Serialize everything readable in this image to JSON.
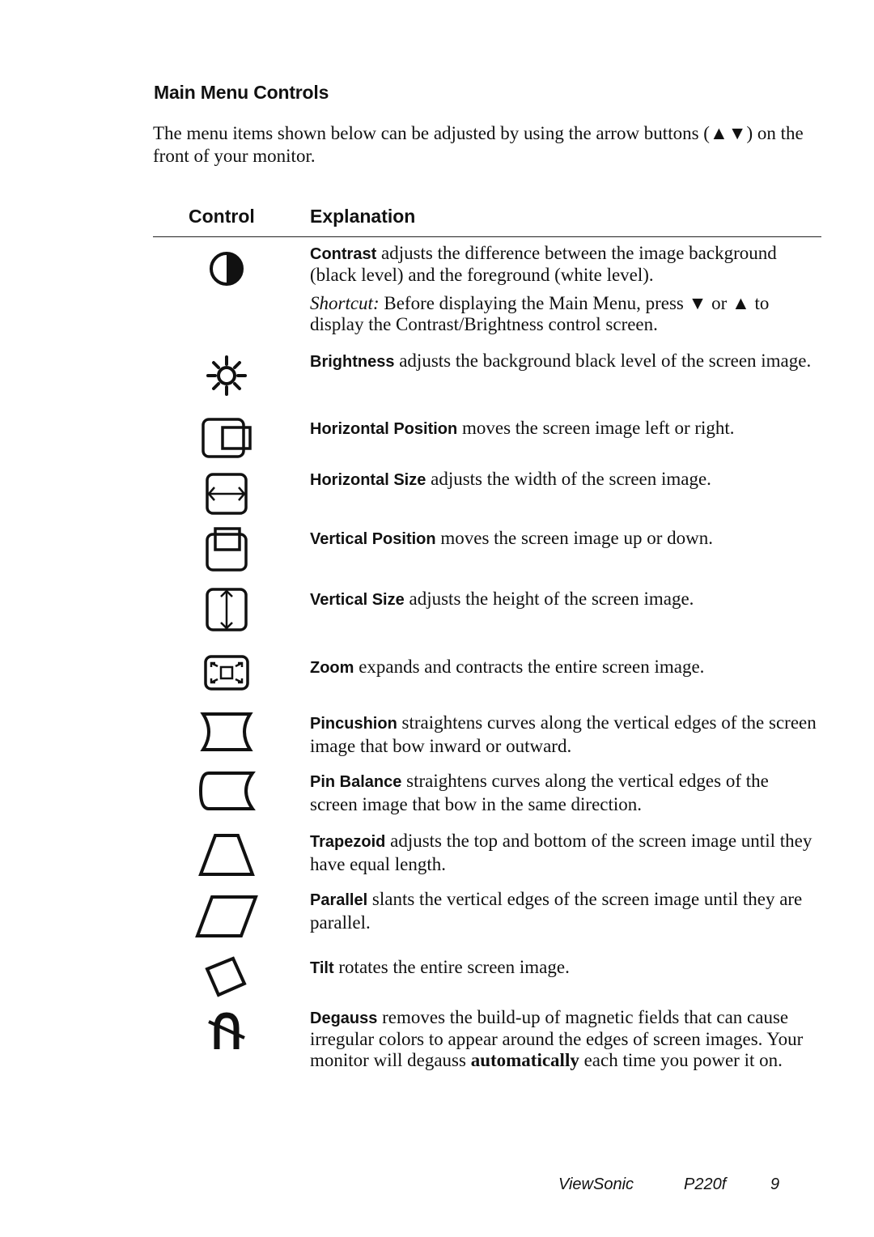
{
  "section": {
    "title": "Main Menu Controls",
    "intro": "The menu items shown below can be adjusted by using the arrow buttons (▲▼) on the front of your monitor."
  },
  "table": {
    "headers": {
      "control": "Control",
      "explanation": "Explanation"
    },
    "rows": [
      {
        "icon": "contrast-icon",
        "term": "Contrast",
        "text": " adjusts the difference between the image background (black level) and the foreground (white level).",
        "shortcut_label": "Shortcut:",
        "shortcut_text": " Before displaying the Main Menu, press ▼ or ▲ to display the Contrast/Brightness control screen."
      },
      {
        "icon": "brightness-icon",
        "term": "Brightness",
        "text": " adjusts the background black level of the screen image."
      },
      {
        "icon": "horizontal-position-icon",
        "term": "Horizontal Position",
        "text": " moves the screen image left or right."
      },
      {
        "icon": "horizontal-size-icon",
        "term": "Horizontal Size",
        "text": " adjusts the width of the screen image."
      },
      {
        "icon": "vertical-position-icon",
        "term": "Vertical Position",
        "text": " moves the screen image up or down."
      },
      {
        "icon": "vertical-size-icon",
        "term": "Vertical Size",
        "text": " adjusts the height of the screen image."
      },
      {
        "icon": "zoom-icon",
        "term": "Zoom",
        "text": " expands and contracts the entire screen image."
      },
      {
        "icon": "pincushion-icon",
        "term": "Pincushion",
        "text": " straightens curves along the vertical edges of the screen image that bow inward or outward."
      },
      {
        "icon": "pin-balance-icon",
        "term": "Pin Balance",
        "text": " straightens curves along the vertical edges of the screen image that bow in the same direction."
      },
      {
        "icon": "trapezoid-icon",
        "term": "Trapezoid",
        "text": " adjusts the top and bottom of the screen image until they have equal length."
      },
      {
        "icon": "parallel-icon",
        "term": "Parallel",
        "text": " slants the vertical edges of the screen image until they are parallel."
      },
      {
        "icon": "tilt-icon",
        "term": "Tilt",
        "text": " rotates the entire screen image."
      },
      {
        "icon": "degauss-icon",
        "term": "Degauss",
        "text": " removes the build-up of magnetic fields that can cause irregular colors to appear around the edges of screen images. Your monitor will degauss ",
        "text_bold": "automatically",
        "text_end": " each time you power it on."
      }
    ]
  },
  "footer": {
    "brand": "ViewSonic",
    "model": "P220f",
    "page": "9"
  }
}
